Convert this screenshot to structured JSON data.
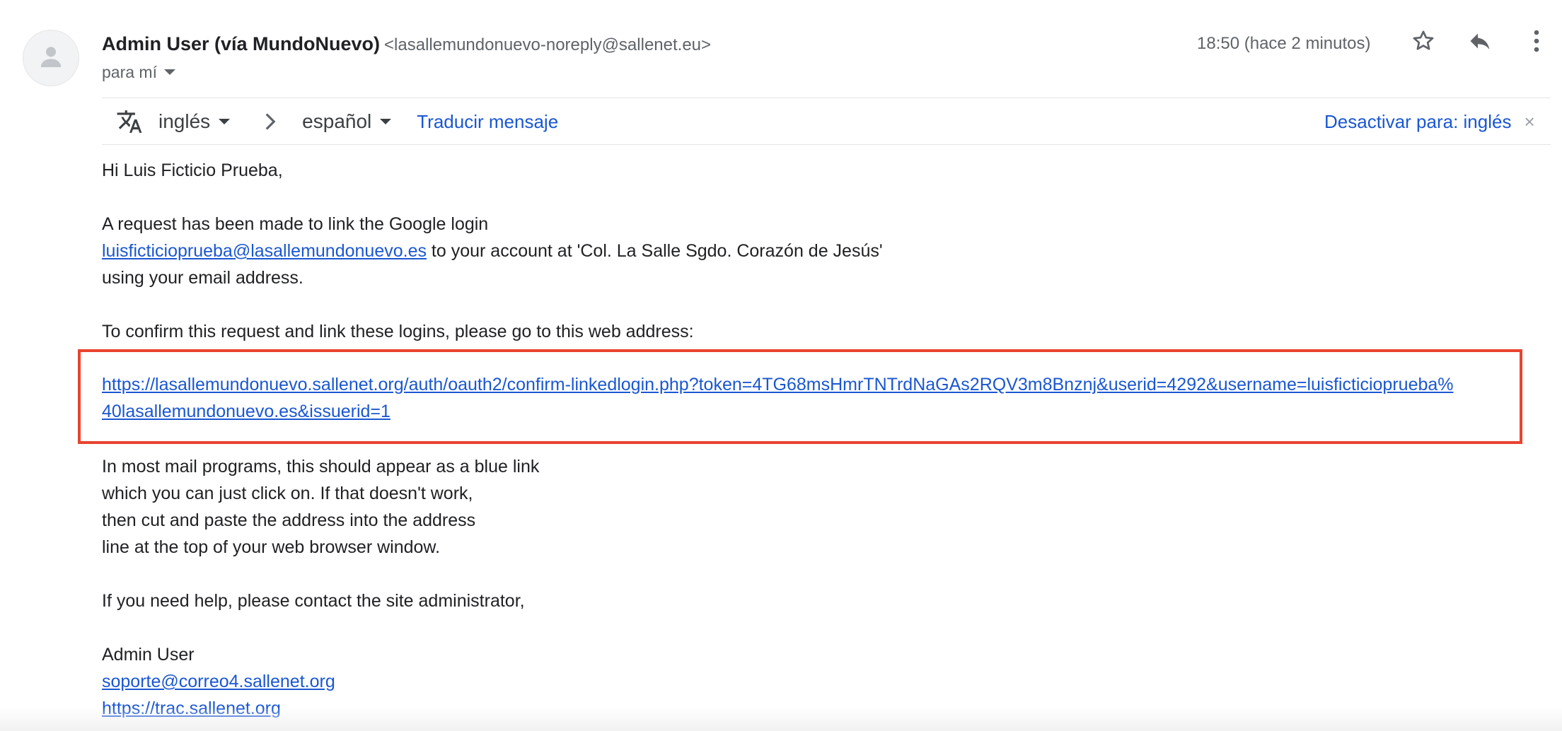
{
  "header": {
    "sender_name": "Admin User (vía MundoNuevo)",
    "sender_email": "<lasallemundonuevo-noreply@sallenet.eu>",
    "to_label": "para mí",
    "timestamp": "18:50 (hace 2 minutos)",
    "icons": [
      "person-icon",
      "star-icon",
      "reply-icon",
      "more-vert-icon"
    ]
  },
  "translate_bar": {
    "source_lang": "inglés",
    "target_lang": "español",
    "translate_label": "Traducir mensaje",
    "disable_label": "Desactivar para: inglés",
    "close_symbol": "×"
  },
  "message": {
    "greeting": "Hi Luis Ficticio Prueba,",
    "p1_line1": "A request has been made to link the Google login",
    "p1_link": "luisficticioprueba@lasallemundonuevo.es",
    "p1_line2_rest": " to your account at 'Col. La Salle Sgdo. Corazón de Jesús'",
    "p1_line3": "using your email address.",
    "p2": "To confirm this request and link these logins, please go to this web address:",
    "url_line1": "https://lasallemundonuevo.sallenet.org/auth/oauth2/confirm-linkedlogin.php?token=4TG68msHmrTNTrdNaGAs2RQV3m8Bnznj&userid=4292&username=luisficticioprueba%",
    "url_line2": "40lasallemundonuevo.es&issuerid=1",
    "p3_line1": "In most mail programs, this should appear as a blue link",
    "p3_line2": "which you can just click on. If that doesn't work,",
    "p3_line3": "then cut and paste the address into the address",
    "p3_line4": "line at the top of your web browser window.",
    "p4": "If you need help, please contact the site administrator,",
    "signature_name": "Admin User",
    "signature_email": "soporte@correo4.sallenet.org",
    "signature_url": "https://trac.sallenet.org"
  },
  "colors": {
    "link": "#1a57d2",
    "highlight_border": "#e8432e",
    "text": "#202124",
    "muted": "#5f6368"
  }
}
